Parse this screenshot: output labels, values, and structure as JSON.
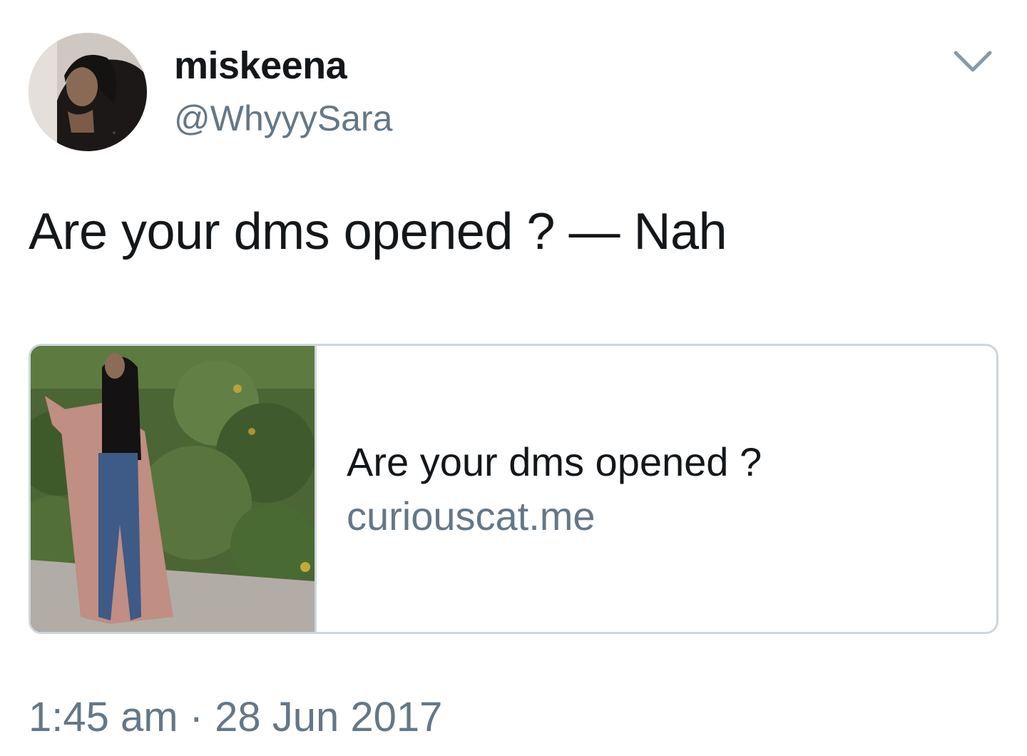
{
  "user": {
    "display_name": "miskeena",
    "handle": "@WhyyySara"
  },
  "tweet": {
    "text": "Are your dms opened ? — Nah",
    "timestamp": "1:45 am · 28 Jun 2017"
  },
  "card": {
    "title": "Are your dms opened ?",
    "domain": "curiouscat.me"
  },
  "icons": {
    "menu": "chevron-down-icon"
  },
  "colors": {
    "text_primary": "#14171a",
    "text_secondary": "#657786",
    "card_border": "#ccd6dd",
    "background": "#ffffff"
  }
}
